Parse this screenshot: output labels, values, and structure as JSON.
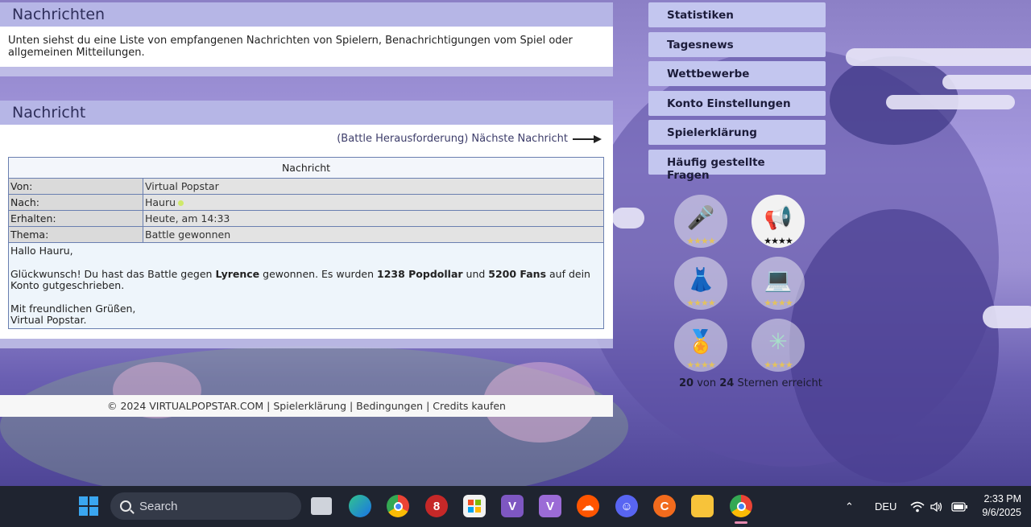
{
  "nachrichten": {
    "title": "Nachrichten",
    "intro": "Unten siehst du eine Liste von empfangenen Nachrichten von Spielern, Benachrichtigungen vom Spiel oder allgemeinen Mitteilungen."
  },
  "nachricht": {
    "title": "Nachricht",
    "next_link": "(Battle Herausforderung) Nächste Nachricht",
    "table_header": "Nachricht",
    "rows": [
      {
        "label": "Von:",
        "value": "Virtual Popstar"
      },
      {
        "label": "Nach:",
        "value": "Hauru"
      },
      {
        "label": "Erhalten:",
        "value": "Heute, am 14:33"
      },
      {
        "label": "Thema:",
        "value": "Battle gewonnen"
      }
    ],
    "body": {
      "greeting": "Hallo Hauru,",
      "line_pre": "Glückwunsch! Du hast das Battle gegen ",
      "opponent": "Lyrence",
      "line_mid1": " gewonnen. Es wurden ",
      "popdollar": "1238 Popdollar",
      "line_mid2": " und ",
      "fans": "5200 Fans",
      "line_post": " auf dein Konto gutgeschrieben.",
      "closing1": "Mit freundlichen Grüßen,",
      "closing2": "Virtual Popstar."
    }
  },
  "footer": {
    "copyright": "© 2024 VIRTUALPOPSTAR.COM",
    "sep": " | ",
    "links": [
      "Spielerklärung",
      "Bedingungen",
      "Credits kaufen"
    ]
  },
  "menu": {
    "items": [
      "Statistiken",
      "Tagesnews",
      "Wettbewerbe",
      "Konto Einstellungen",
      "Spielerklärung",
      "Häufig gestellte Fragen"
    ]
  },
  "badges": {
    "items": [
      {
        "icon": "microphone-icon",
        "glyph": "🎤",
        "stars": "★★★★",
        "active": false
      },
      {
        "icon": "megaphone-icon",
        "glyph": "📢",
        "stars": "★★★★",
        "active": true
      },
      {
        "icon": "dress-icon",
        "glyph": "👗",
        "stars": "★★★★",
        "active": false
      },
      {
        "icon": "laptop-icon",
        "glyph": "💻",
        "stars": "★★★★",
        "active": false
      },
      {
        "icon": "medal-icon",
        "glyph": "🏅",
        "stars": "★★★★",
        "active": false
      },
      {
        "icon": "compass-icon",
        "glyph": "✳",
        "stars": "★★★★",
        "active": false
      }
    ],
    "earned": "20",
    "von": " von ",
    "total": "24",
    "suffix": " Sternen erreicht"
  },
  "taskbar": {
    "search_placeholder": "Search",
    "language": "DEU",
    "time": "2:33 PM",
    "date": "9/6/2025"
  }
}
